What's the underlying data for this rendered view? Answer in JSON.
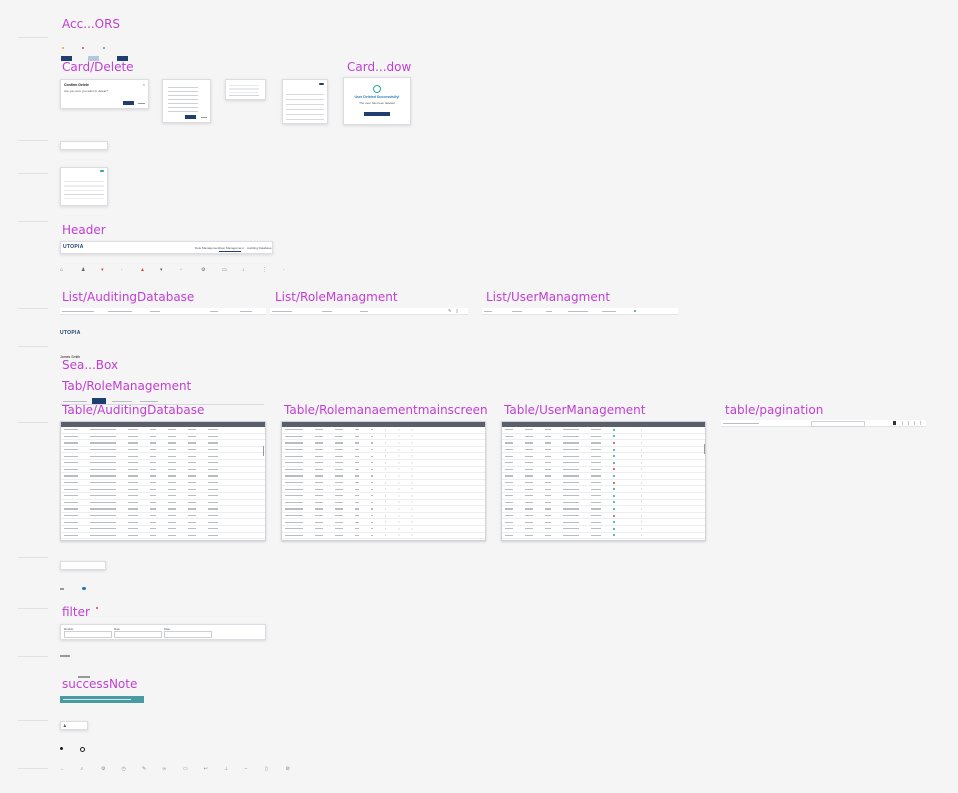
{
  "colors": {
    "label": "#c23ed3",
    "primary": "#1f3f6e",
    "teal": "#4a9aa2",
    "success": "#2aa79a",
    "danger": "#d9473c",
    "warn": "#e9a23b"
  },
  "sections": {
    "accessors": "Acc...ORS",
    "card_delete": "Card/Delete",
    "card_window": "Card...dow",
    "header": "Header",
    "list_auditing": "List/AuditingDatabase",
    "list_role": "List/RoleManagment",
    "list_user": "List/UserManagment",
    "search_box": "Sea...Box",
    "tab_role": "Tab/RoleManagement",
    "table_auditing": "Table/AuditingDatabase",
    "table_role": "Table/Rolemanaementmainscreen",
    "table_user": "Table/UserManagement",
    "table_pagination": "table/pagination",
    "filter": "filter",
    "success_note": "successNote"
  },
  "delete_dialog": {
    "title": "Confirm Delete",
    "message": "Are you sure you want to delete?"
  },
  "success_dialog": {
    "title": "User Deleted Successfully!",
    "message": "The user has been deleted"
  },
  "header": {
    "logo": "UTOPIA",
    "nav": [
      "Role Management",
      "User Management",
      "Auditing Database"
    ]
  },
  "logo_small": "UTOPIA",
  "user_name": "James Smith",
  "icons": [
    "home-icon",
    "user-icon",
    "filter-icon",
    "dot-icon",
    "alert-icon",
    "chevron-icon",
    "box-icon",
    "gear-icon",
    "copy-icon",
    "download-icon",
    "more-icon"
  ],
  "bottom_icons": [
    "arrow-icon",
    "search-icon",
    "gear-icon",
    "clock-icon",
    "edit-icon",
    "link-icon",
    "copy-icon",
    "back-icon",
    "pin-icon",
    "dash-icon",
    "trash-icon",
    "settings-icon"
  ],
  "table_auditing": {
    "rows": 17
  },
  "table_role": {
    "rows": 17
  },
  "table_user": {
    "rows": 17,
    "status": [
      "success",
      "success",
      "danger",
      "success",
      "success",
      "success",
      "danger",
      "success",
      "danger",
      "success",
      "success",
      "success",
      "success",
      "danger",
      "success",
      "success",
      "success"
    ]
  },
  "filter": {
    "fields": [
      "Module",
      "Role",
      "Date"
    ]
  }
}
